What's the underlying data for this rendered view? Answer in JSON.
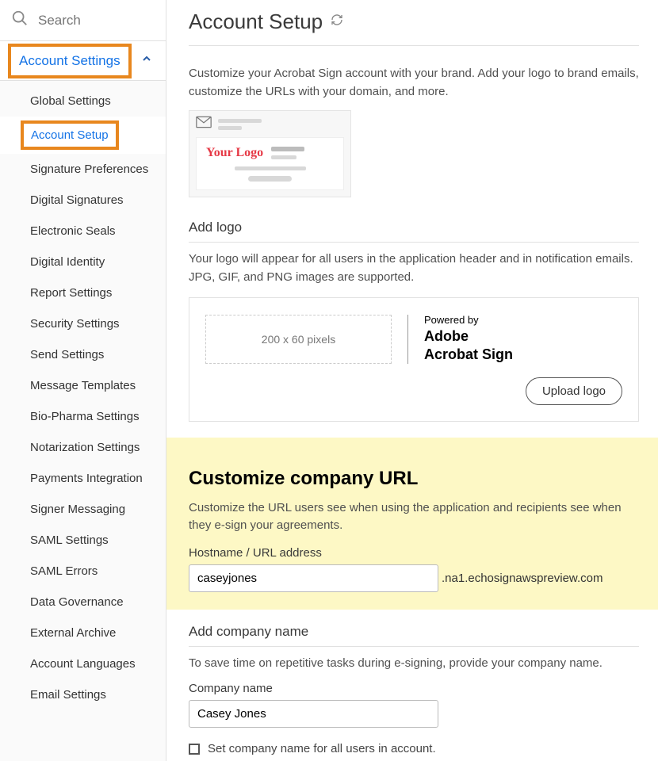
{
  "sidebar": {
    "search_placeholder": "Search",
    "section_label": "Account Settings",
    "items": [
      {
        "label": "Global Settings",
        "active": false
      },
      {
        "label": "Account Setup",
        "active": true
      },
      {
        "label": "Signature Preferences",
        "active": false
      },
      {
        "label": "Digital Signatures",
        "active": false
      },
      {
        "label": "Electronic Seals",
        "active": false
      },
      {
        "label": "Digital Identity",
        "active": false
      },
      {
        "label": "Report Settings",
        "active": false
      },
      {
        "label": "Security Settings",
        "active": false
      },
      {
        "label": "Send Settings",
        "active": false
      },
      {
        "label": "Message Templates",
        "active": false
      },
      {
        "label": "Bio-Pharma Settings",
        "active": false
      },
      {
        "label": "Notarization Settings",
        "active": false
      },
      {
        "label": "Payments Integration",
        "active": false
      },
      {
        "label": "Signer Messaging",
        "active": false
      },
      {
        "label": "SAML Settings",
        "active": false
      },
      {
        "label": "SAML Errors",
        "active": false
      },
      {
        "label": "Data Governance",
        "active": false
      },
      {
        "label": "External Archive",
        "active": false
      },
      {
        "label": "Account Languages",
        "active": false
      },
      {
        "label": "Email Settings",
        "active": false
      }
    ]
  },
  "page": {
    "title": "Account Setup",
    "intro": "Customize your Acrobat Sign account with your brand. Add your logo to brand emails, customize the URLs with your domain, and more.",
    "illus_logo_text": "Your Logo"
  },
  "logo_section": {
    "heading": "Add logo",
    "desc": "Your logo will appear for all users in the application header and in notification emails. JPG, GIF, and PNG images are supported.",
    "dropzone": "200 x 60 pixels",
    "powered_label": "Powered by",
    "brand_line1": "Adobe",
    "brand_line2": "Acrobat Sign",
    "upload_btn": "Upload logo"
  },
  "url_section": {
    "heading": "Customize company URL",
    "desc": "Customize the URL users see when using the application and recipients see when they e-sign your agreements.",
    "field_label": "Hostname / URL address",
    "value": "caseyjones",
    "suffix": ".na1.echosignawspreview.com"
  },
  "company_section": {
    "heading": "Add company name",
    "desc": "To save time on repetitive tasks during e-signing, provide your company name.",
    "field_label": "Company name",
    "value": "Casey Jones",
    "checkbox_label": "Set company name for all users in account."
  }
}
